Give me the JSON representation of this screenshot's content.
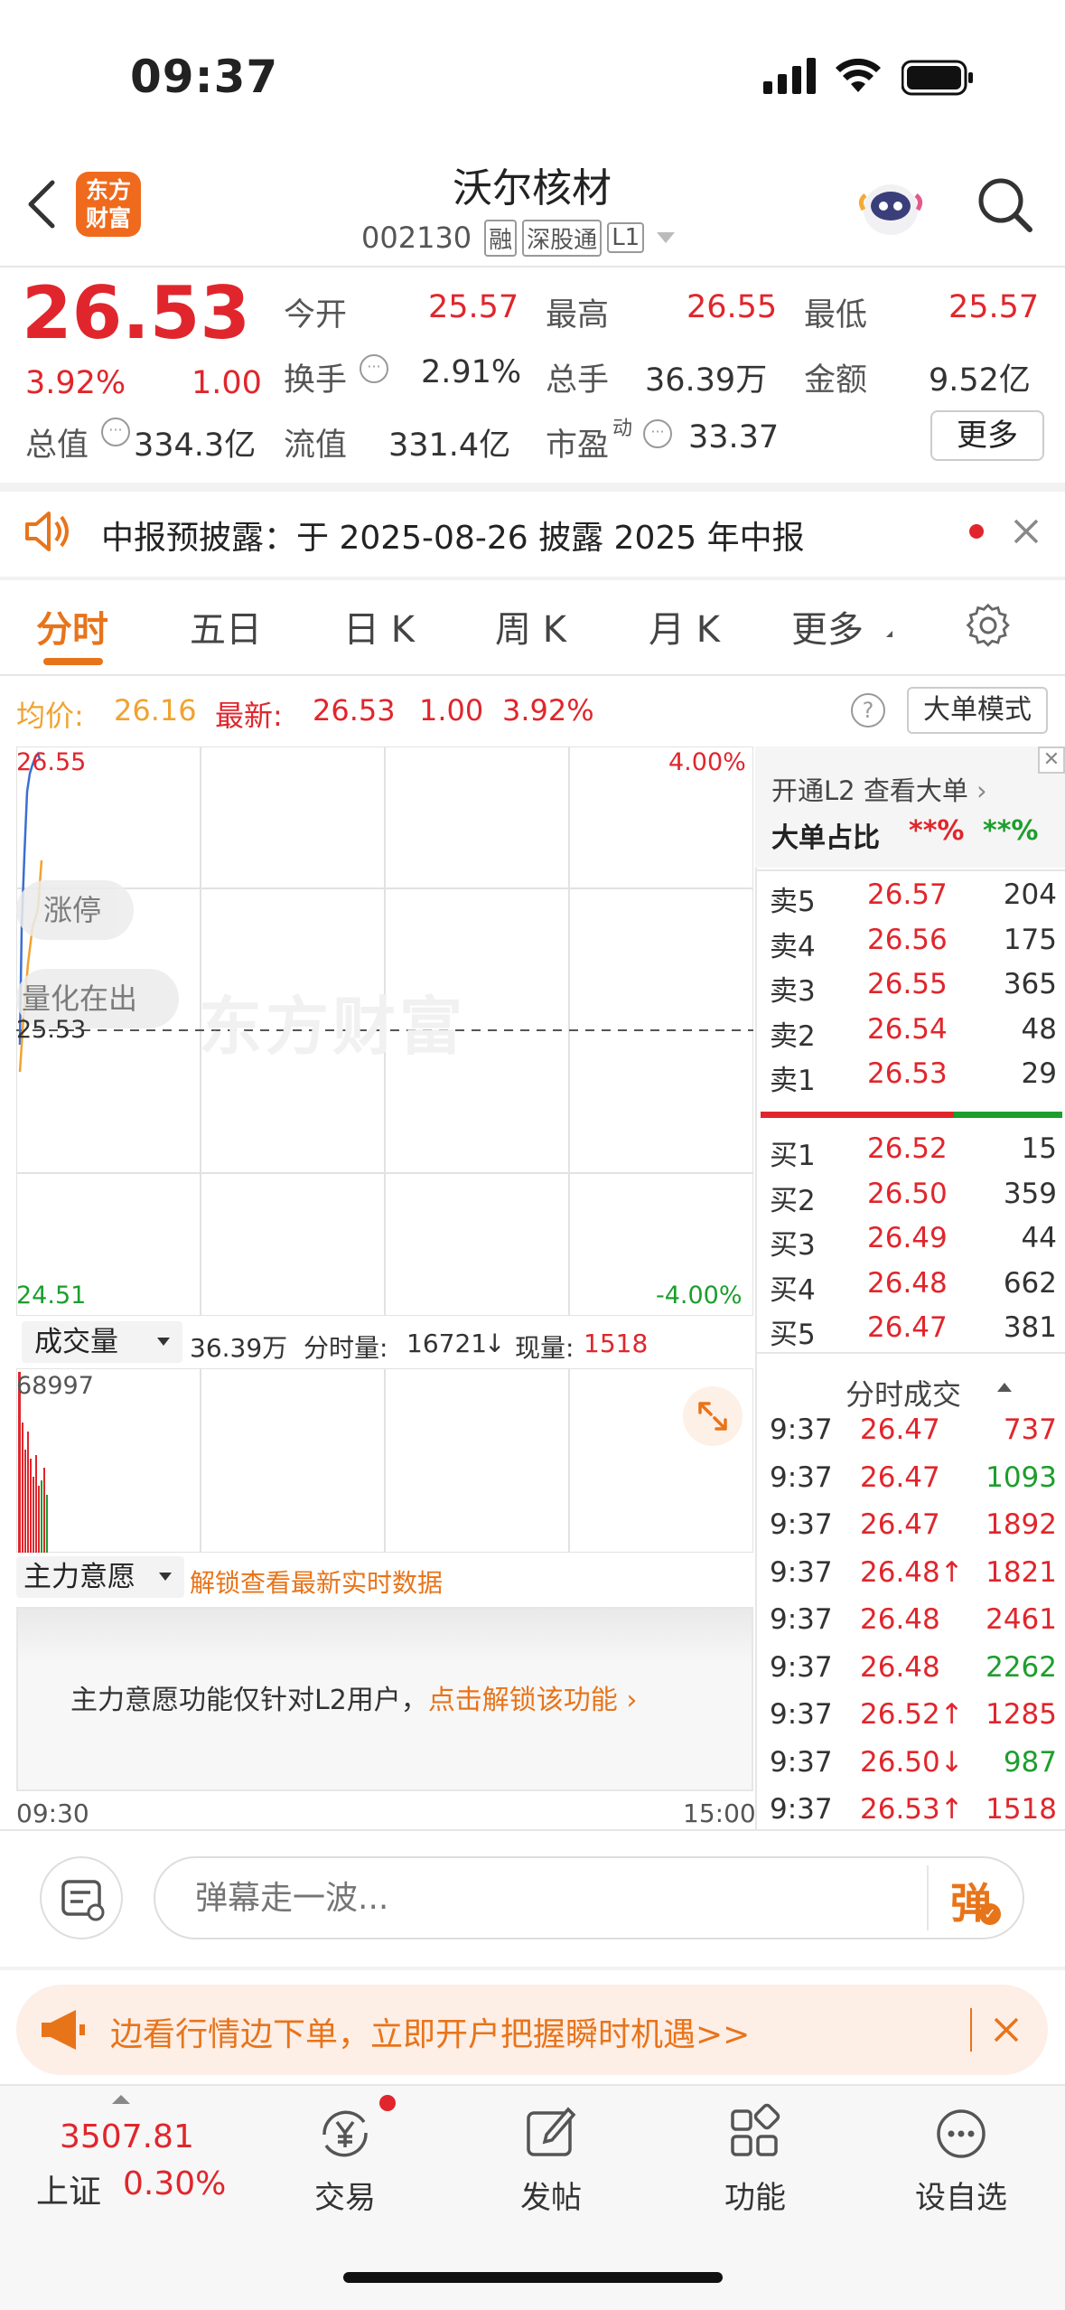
{
  "status": {
    "time": "09:37"
  },
  "header": {
    "title": "沃尔核材",
    "code": "002130",
    "tags": [
      "融",
      "深股通",
      "L1"
    ],
    "logo_line1": "东方",
    "logo_line2": "财富"
  },
  "quote": {
    "price": "26.53",
    "change_pct": "3.92%",
    "change": "1.00",
    "open_label": "今开",
    "open": "25.57",
    "high_label": "最高",
    "high": "26.55",
    "low_label": "最低",
    "low": "25.57",
    "turnover_label": "换手",
    "turnover": "2.91%",
    "vol_label": "总手",
    "vol": "36.39万",
    "amount_label": "金额",
    "amount": "9.52亿",
    "mcap_label": "总值",
    "mcap": "334.3亿",
    "float_label": "流值",
    "float": "331.4亿",
    "pe_label": "市盈",
    "pe_sup": "动",
    "pe": "33.37",
    "more_label": "更多"
  },
  "notice": {
    "text": "中报预披露：于 2025-08-26 披露 2025 年中报"
  },
  "tabs": [
    "分时",
    "五日",
    "日 K",
    "周 K",
    "月 K",
    "更多"
  ],
  "chart_info": {
    "avg_label": "均价:",
    "avg": "26.16",
    "latest_label": "最新:",
    "latest": "26.53",
    "chg": "1.00",
    "pct": "3.92%",
    "mode_button": "大单模式"
  },
  "chart": {
    "top_price": "26.55",
    "top_pct": "4.00%",
    "base_price": "25.53",
    "bottom_price": "24.51",
    "bottom_pct": "-4.00%",
    "pill1": "涨停",
    "pill2": "量化在出",
    "watermark": "东方财富",
    "time_start": "09:30",
    "time_end": "15:00"
  },
  "volume": {
    "selector": "成交量",
    "total": "36.39万",
    "minute_label": "分时量:",
    "minute": "16721",
    "arrow": "↓",
    "now_label": "现量:",
    "now": "1518",
    "max": "68997"
  },
  "mainforce": {
    "selector": "主力意愿",
    "unlock_hint": "解锁查看最新实时数据",
    "msg": "主力意愿功能仅针对L2用户，",
    "link": "点击解锁该功能"
  },
  "orderbook": {
    "l2_link": "开通L2 查看大单",
    "big_label": "大单占比",
    "big_sell": "**%",
    "big_buy": "**%",
    "asks": [
      {
        "l": "卖5",
        "p": "26.57",
        "v": "204"
      },
      {
        "l": "卖4",
        "p": "26.56",
        "v": "175"
      },
      {
        "l": "卖3",
        "p": "26.55",
        "v": "365"
      },
      {
        "l": "卖2",
        "p": "26.54",
        "v": "48"
      },
      {
        "l": "卖1",
        "p": "26.53",
        "v": "29"
      }
    ],
    "bids": [
      {
        "l": "买1",
        "p": "26.52",
        "v": "15"
      },
      {
        "l": "买2",
        "p": "26.50",
        "v": "359"
      },
      {
        "l": "买3",
        "p": "26.49",
        "v": "44"
      },
      {
        "l": "买4",
        "p": "26.48",
        "v": "662"
      },
      {
        "l": "买5",
        "p": "26.47",
        "v": "381"
      }
    ],
    "sell_ratio": 0.64
  },
  "trades": {
    "title": "分时成交",
    "rows": [
      {
        "t": "9:37",
        "p": "26.47",
        "v": "737",
        "vc": "red"
      },
      {
        "t": "9:37",
        "p": "26.47",
        "v": "1093",
        "vc": "green"
      },
      {
        "t": "9:37",
        "p": "26.47",
        "v": "1892",
        "vc": "red"
      },
      {
        "t": "9:37",
        "p": "26.48↑",
        "v": "1821",
        "vc": "red"
      },
      {
        "t": "9:37",
        "p": "26.48",
        "v": "2461",
        "vc": "red"
      },
      {
        "t": "9:37",
        "p": "26.48",
        "v": "2262",
        "vc": "green"
      },
      {
        "t": "9:37",
        "p": "26.52↑",
        "v": "1285",
        "vc": "red"
      },
      {
        "t": "9:37",
        "p": "26.50↓",
        "v": "987",
        "vc": "green"
      },
      {
        "t": "9:37",
        "p": "26.53↑",
        "v": "1518",
        "vc": "red"
      }
    ]
  },
  "comment": {
    "placeholder": "弹幕走一波...",
    "danmu": "弹"
  },
  "banner": {
    "text": "边看行情边下单，立即开户把握瞬时机遇>>"
  },
  "bottom_nav": {
    "index_value": "3507.81",
    "index_name": "上证",
    "index_pct": "0.30%",
    "items": [
      "交易",
      "发帖",
      "功能",
      "设自选"
    ]
  },
  "colors": {
    "up": "#e0262c",
    "down": "#1d9e2d",
    "accent": "#e8741a"
  }
}
